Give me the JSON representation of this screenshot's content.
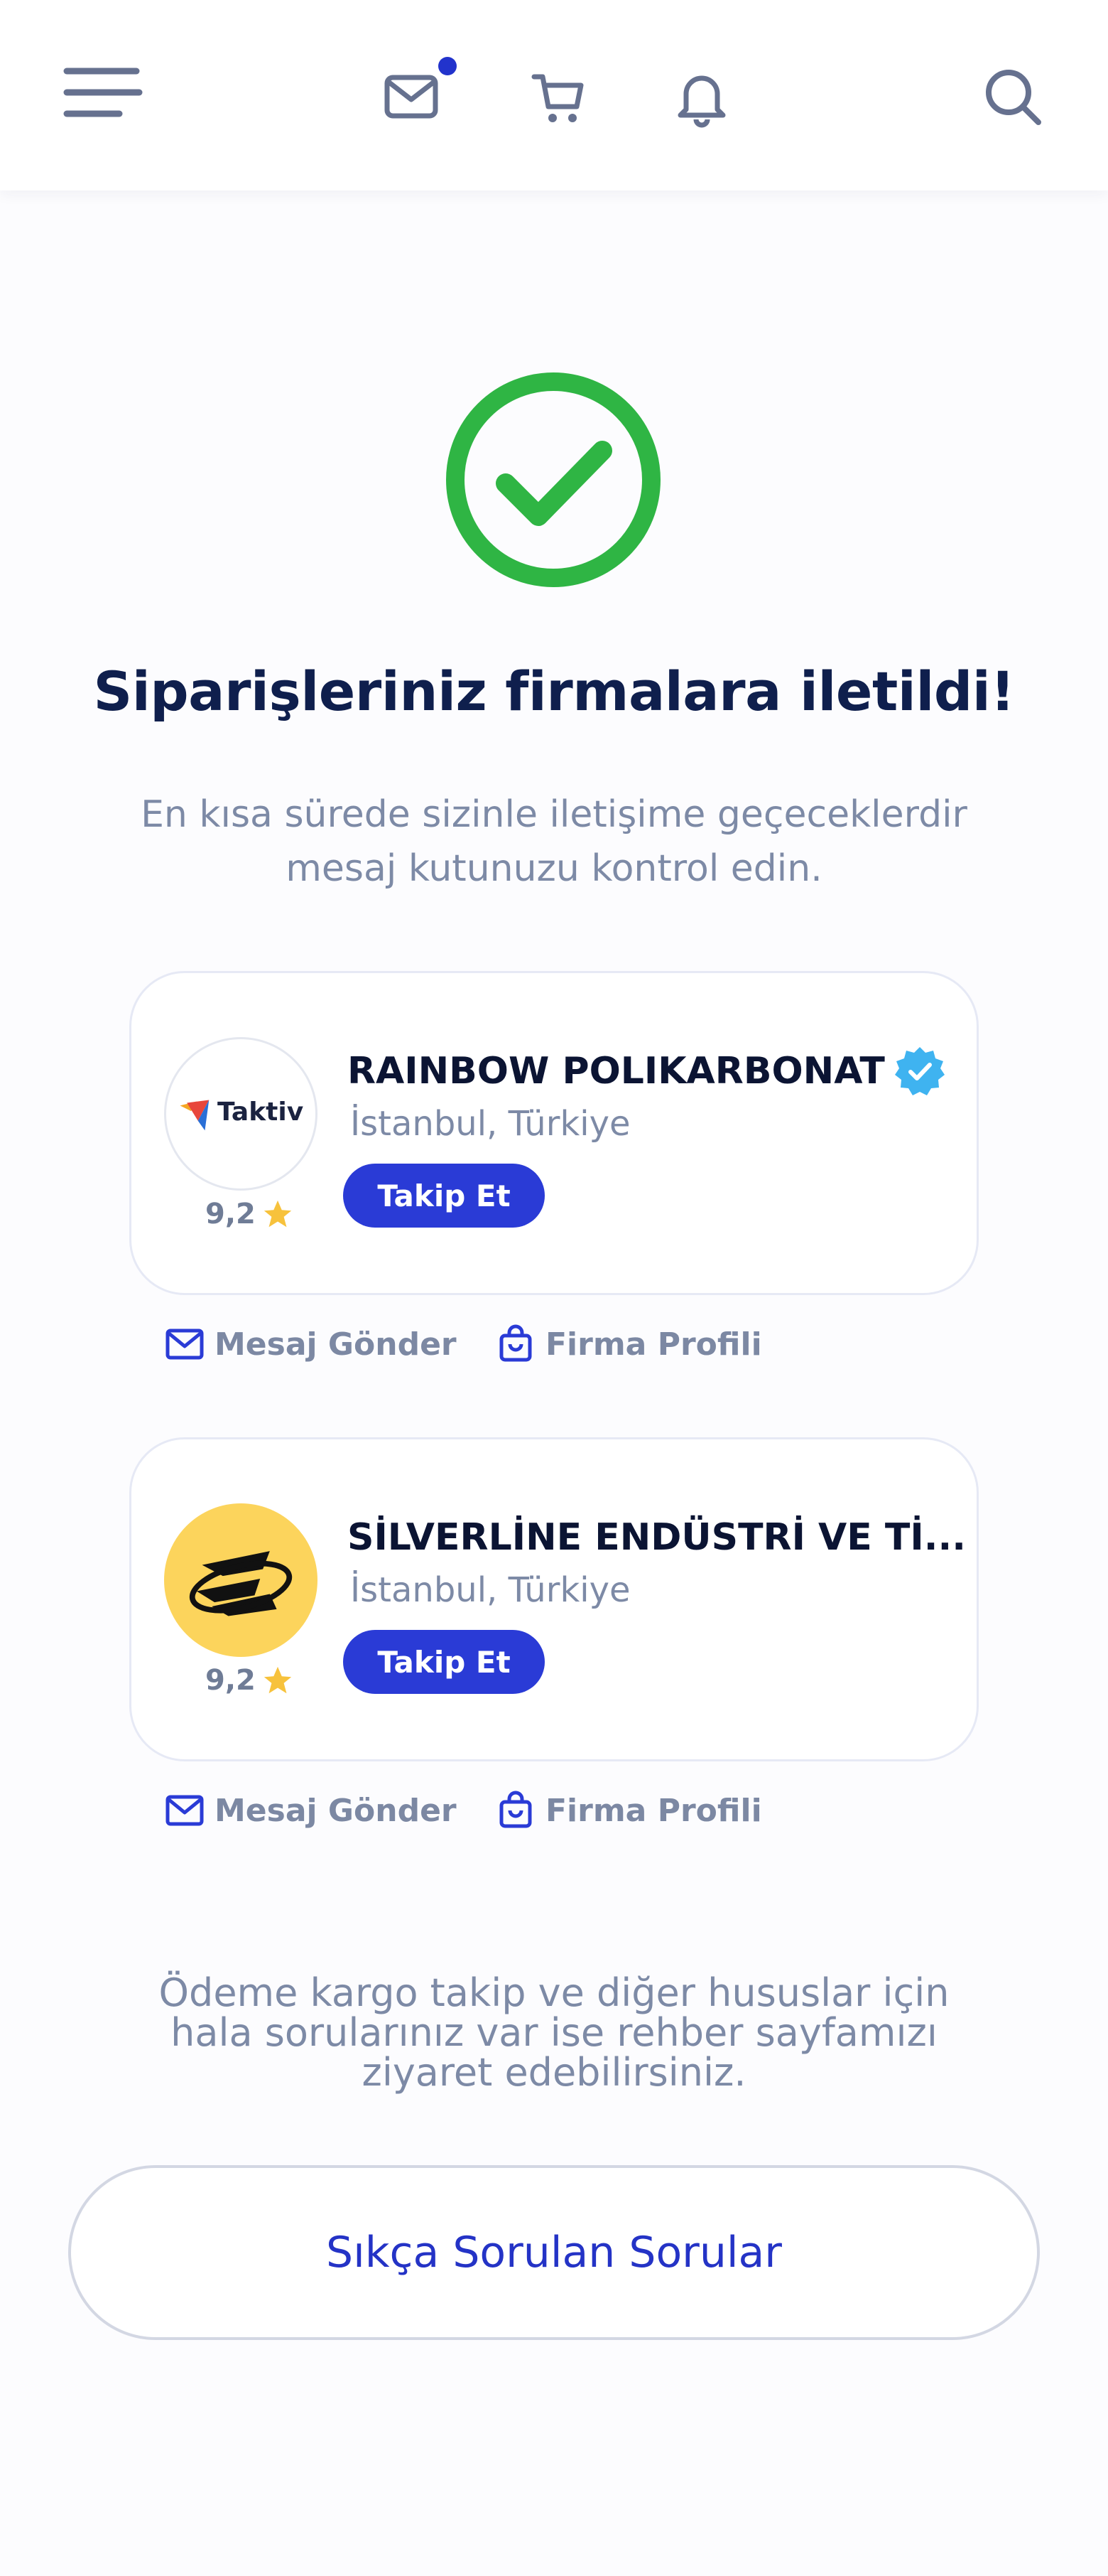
{
  "header": {
    "icons": [
      "menu-icon",
      "mail-icon",
      "cart-icon",
      "bell-icon",
      "search-icon"
    ],
    "mail_has_notification": true,
    "accent": "#2233cc",
    "icon_color": "#66718f"
  },
  "confirmation": {
    "icon": "check-circle-icon",
    "icon_color": "#2fb544",
    "title": "Siparişleriniz firmalara iletildi!",
    "subtitle_line1": "En kısa sürede sizinle iletişime geçeceklerdir",
    "subtitle_line2": "mesaj kutunuzu kontrol edin."
  },
  "companies": [
    {
      "name": "RAINBOW POLIKARBONAT",
      "verified": true,
      "location": "İstanbul, Türkiye",
      "rating": "9,2",
      "logo_text": "Taktiv",
      "follow_label": "Takip Et",
      "message_label": "Mesaj Gönder",
      "profile_label": "Firma Profili"
    },
    {
      "name": "SİLVERLİNE ENDÜSTRİ VE Tİ...",
      "verified": false,
      "location": "İstanbul, Türkiye",
      "rating": "9,2",
      "logo_text": "",
      "follow_label": "Takip Et",
      "message_label": "Mesaj Gönder",
      "profile_label": "Firma Profili"
    }
  ],
  "footer": {
    "line1": "Ödeme kargo takip ve diğer hususlar için",
    "line2": "hala sorularınız var ise rehber sayfamızı",
    "line3": "ziyaret edebilirsiniz.",
    "faq_button": "Sıkça Sorulan Sorular"
  },
  "colors": {
    "primary": "#2a3bd6",
    "title": "#0f1f4d",
    "muted": "#7d8aa6",
    "star": "#f7c23c",
    "verified": "#3fb3f0"
  }
}
